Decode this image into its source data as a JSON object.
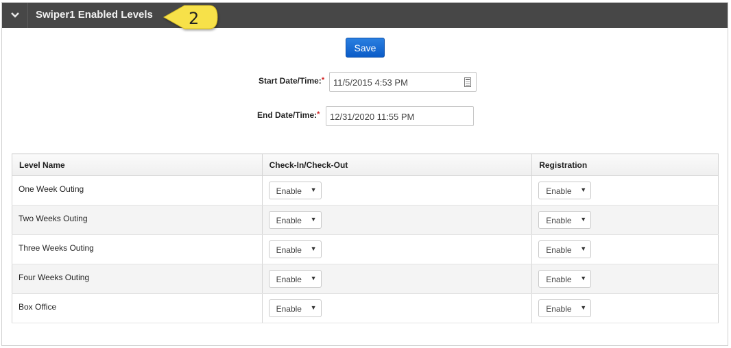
{
  "header": {
    "title": "Swiper1 Enabled Levels",
    "callout_number": "2",
    "callout_color": "#f7e14a"
  },
  "form": {
    "save_label": "Save",
    "start_label": "Start Date/Time:",
    "start_value": "11/5/2015 4:53 PM",
    "end_label": "End Date/Time:",
    "end_value": "12/31/2020 11:55 PM",
    "required_mark": "*"
  },
  "table": {
    "columns": [
      "Level Name",
      "Check-In/Check-Out",
      "Registration"
    ],
    "rows": [
      {
        "name": "One Week Outing",
        "checkin": "Enable",
        "registration": "Enable"
      },
      {
        "name": "Two Weeks Outing",
        "checkin": "Enable",
        "registration": "Enable"
      },
      {
        "name": "Three Weeks Outing",
        "checkin": "Enable",
        "registration": "Enable"
      },
      {
        "name": "Four Weeks Outing",
        "checkin": "Enable",
        "registration": "Enable"
      },
      {
        "name": "Box Office",
        "checkin": "Enable",
        "registration": "Enable"
      }
    ]
  },
  "colors": {
    "header_bg": "#474747",
    "save_button": "#0b5cc8",
    "required": "#d02020"
  }
}
